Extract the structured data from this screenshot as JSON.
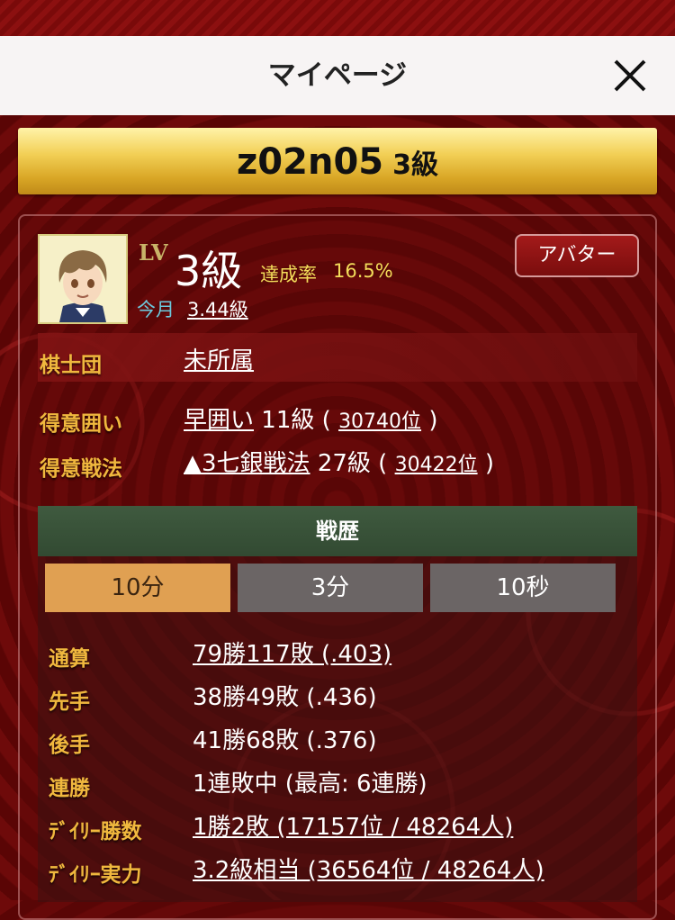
{
  "header": {
    "title": "マイページ"
  },
  "banner": {
    "username": "z02n05",
    "rank": "3級"
  },
  "profile": {
    "lv_label": "LV",
    "level": "3級",
    "rate_label": "達成率",
    "rate_value": "16.5%",
    "month_label": "今月",
    "month_value": "3.44級",
    "avatar_button": "アバター"
  },
  "info": {
    "guild_label": "棋士団",
    "guild_value": "未所属",
    "castle_label": "得意囲い",
    "castle_name": "早囲い",
    "castle_rank": "11級",
    "castle_position": "30740位",
    "strategy_label": "得意戦法",
    "strategy_name": "▲3七銀戦法",
    "strategy_rank": "27級",
    "strategy_position": "30422位",
    "open_paren": "(",
    "close_paren": ")"
  },
  "history": {
    "title": "戦歴",
    "tabs": [
      "10分",
      "3分",
      "10秒"
    ],
    "active_tab": 0,
    "rows": [
      {
        "label": "通算",
        "value": "79勝117敗 (.403)",
        "link": true
      },
      {
        "label": "先手",
        "value": "38勝49敗 (.436)",
        "link": false
      },
      {
        "label": "後手",
        "value": "41勝68敗 (.376)",
        "link": false
      },
      {
        "label": "連勝",
        "value": "1連敗中 (最高: 6連勝)",
        "link": false
      },
      {
        "label": "ﾃﾞｲﾘｰ勝数",
        "value": "1勝2敗 (17157位 / 48264人)",
        "link": true
      },
      {
        "label": "ﾃﾞｲﾘｰ実力",
        "value": "3.2級相当 (36564位 / 48264人)",
        "link": true
      }
    ]
  },
  "icons": {
    "close": "close-icon",
    "avatar": "avatar-image"
  },
  "colors": {
    "background": "#5e0606",
    "gold_label": "#f0b83e",
    "rate_text": "#f3dc5a",
    "month_text": "#6cc9dd",
    "tab_active": "#e0a052",
    "tab_inactive": "#6b6565",
    "history_header": "#3f5a3f"
  }
}
